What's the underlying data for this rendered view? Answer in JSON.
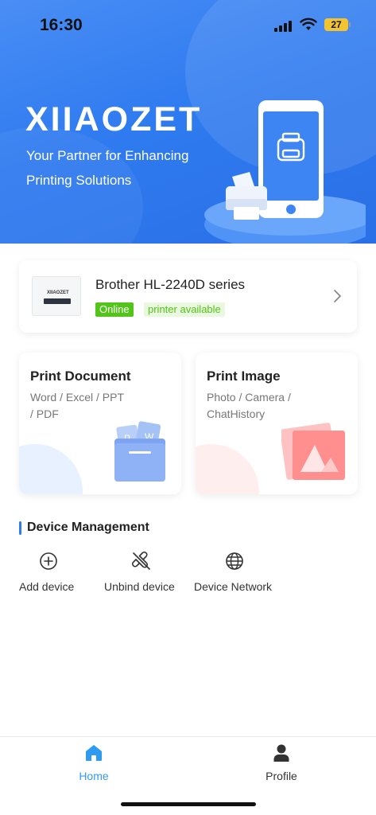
{
  "status_bar": {
    "time": "16:30",
    "battery": "27"
  },
  "hero": {
    "brand": "XIIAOZET",
    "tagline_line1": "Your Partner for Enhancing",
    "tagline_line2": "Printing Solutions"
  },
  "printer": {
    "thumb_logo": "XIIAOZET",
    "name": "Brother HL-2240D series",
    "status": "Online",
    "availability": "printer available"
  },
  "tiles": [
    {
      "title": "Print Document",
      "sub1": "Word / Excel / PPT",
      "sub2": "/ PDF"
    },
    {
      "title": "Print Image",
      "sub1": "Photo / Camera /",
      "sub2": "ChatHistory"
    }
  ],
  "device_management": {
    "title": "Device Management",
    "actions": [
      {
        "label": "Add device",
        "icon": "plus-circle-icon"
      },
      {
        "label": "Unbind device",
        "icon": "unlink-icon"
      },
      {
        "label": "Device Network",
        "icon": "globe-icon"
      }
    ]
  },
  "tabbar": {
    "home": "Home",
    "profile": "Profile",
    "active_color": "#2f9bf0",
    "inactive_color": "#333333"
  },
  "colors": {
    "hero_blue": "#2f7bf0",
    "online_green": "#52c41a",
    "accent": "#2f7bf0"
  }
}
